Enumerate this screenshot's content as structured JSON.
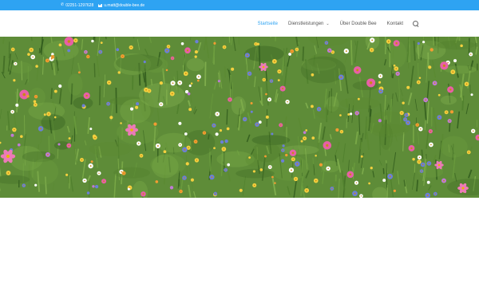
{
  "topbar": {
    "phone": "02251-1297628",
    "email": "u.matt@double-bee.de",
    "phone_icon": "phone-icon",
    "email_icon": "envelope-icon"
  },
  "nav": {
    "items": [
      {
        "label": "Startseite",
        "active": true
      },
      {
        "label": "Dienstleistungen",
        "has_dropdown": true
      },
      {
        "label": "Über Double Bee"
      },
      {
        "label": "Kontakt"
      }
    ],
    "search_icon": "search-icon"
  },
  "hero": {
    "image": "wildflower-meadow",
    "accent": "#2ea3f2"
  }
}
